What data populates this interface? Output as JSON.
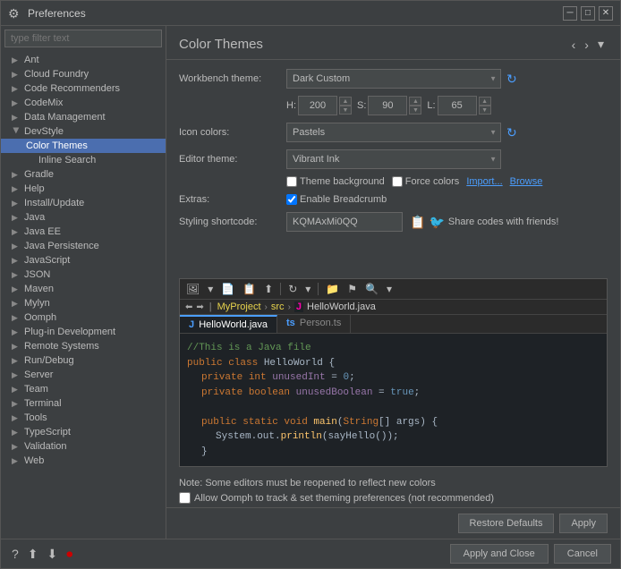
{
  "window": {
    "title": "Preferences",
    "icon": "⚙"
  },
  "filter": {
    "placeholder": "type filter text"
  },
  "sidebar": {
    "items": [
      {
        "id": "ant",
        "label": "Ant",
        "level": "root",
        "expanded": false
      },
      {
        "id": "cloud-foundry",
        "label": "Cloud Foundry",
        "level": "root",
        "expanded": false
      },
      {
        "id": "code-recommenders",
        "label": "Code Recommenders",
        "level": "root",
        "expanded": false
      },
      {
        "id": "codemix",
        "label": "CodeMix",
        "level": "root",
        "expanded": false
      },
      {
        "id": "data-management",
        "label": "Data Management",
        "level": "root",
        "expanded": false
      },
      {
        "id": "devstyle",
        "label": "DevStyle",
        "level": "root",
        "expanded": true
      },
      {
        "id": "color-themes",
        "label": "Color Themes",
        "level": "child",
        "selected": true
      },
      {
        "id": "inline-search",
        "label": "Inline Search",
        "level": "grandchild"
      },
      {
        "id": "gradle",
        "label": "Gradle",
        "level": "root",
        "expanded": false
      },
      {
        "id": "help",
        "label": "Help",
        "level": "root",
        "expanded": false
      },
      {
        "id": "install-update",
        "label": "Install/Update",
        "level": "root",
        "expanded": false
      },
      {
        "id": "java",
        "label": "Java",
        "level": "root",
        "expanded": false
      },
      {
        "id": "java-ee",
        "label": "Java EE",
        "level": "root",
        "expanded": false
      },
      {
        "id": "java-persistence",
        "label": "Java Persistence",
        "level": "root",
        "expanded": false
      },
      {
        "id": "javascript",
        "label": "JavaScript",
        "level": "root",
        "expanded": false
      },
      {
        "id": "json",
        "label": "JSON",
        "level": "root",
        "expanded": false
      },
      {
        "id": "maven",
        "label": "Maven",
        "level": "root",
        "expanded": false
      },
      {
        "id": "mylyn",
        "label": "Mylyn",
        "level": "root",
        "expanded": false
      },
      {
        "id": "oomph",
        "label": "Oomph",
        "level": "root",
        "expanded": false
      },
      {
        "id": "plugin-development",
        "label": "Plug-in Development",
        "level": "root",
        "expanded": false
      },
      {
        "id": "remote-systems",
        "label": "Remote Systems",
        "level": "root",
        "expanded": false
      },
      {
        "id": "run-debug",
        "label": "Run/Debug",
        "level": "root",
        "expanded": false
      },
      {
        "id": "server",
        "label": "Server",
        "level": "root",
        "expanded": false
      },
      {
        "id": "team",
        "label": "Team",
        "level": "root",
        "expanded": false
      },
      {
        "id": "terminal",
        "label": "Terminal",
        "level": "root",
        "expanded": false
      },
      {
        "id": "tools",
        "label": "Tools",
        "level": "root",
        "expanded": false
      },
      {
        "id": "typescript",
        "label": "TypeScript",
        "level": "root",
        "expanded": false
      },
      {
        "id": "validation",
        "label": "Validation",
        "level": "root",
        "expanded": false
      },
      {
        "id": "web",
        "label": "Web",
        "level": "root",
        "expanded": false
      }
    ]
  },
  "content": {
    "title": "Color Themes",
    "workbench_label": "Workbench theme:",
    "workbench_value": "Dark Custom",
    "hsl": {
      "h_label": "H:",
      "h_value": "200",
      "s_label": "S:",
      "s_value": "90",
      "l_label": "L:",
      "l_value": "65"
    },
    "icon_colors_label": "Icon colors:",
    "icon_colors_value": "Pastels",
    "editor_theme_label": "Editor theme:",
    "editor_theme_value": "Vibrant Ink",
    "theme_background_label": "Theme background",
    "force_colors_label": "Force colors",
    "import_label": "Import...",
    "browse_label": "Browse",
    "extras_label": "Extras:",
    "enable_breadcrumb_label": "Enable Breadcrumb",
    "styling_label": "Styling shortcode:",
    "shortcode_value": "KQMAxMi0QQ",
    "share_label": "Share codes with friends!",
    "note": "Note: Some editors must be reopened to reflect new colors",
    "oomph_label": "Allow Oomph to track & set theming preferences (not recommended)",
    "restore_defaults": "Restore Defaults",
    "apply": "Apply"
  },
  "preview": {
    "filename": "HelloWorld.java",
    "path_parts": [
      "MyProject",
      "src",
      "J",
      "HelloWorld.java"
    ],
    "tabs": [
      {
        "label": "HelloWorld.java",
        "prefix": "J",
        "active": true
      },
      {
        "label": "Person.ts",
        "prefix": "ts",
        "active": false
      }
    ],
    "code_lines": [
      {
        "type": "comment",
        "text": "//This is a Java file"
      },
      {
        "type": "mixed",
        "parts": [
          {
            "cls": "code-keyword",
            "text": "public class "
          },
          {
            "cls": "code-class",
            "text": "HelloWorld "
          },
          {
            "cls": "code-plain",
            "text": "{"
          }
        ]
      },
      {
        "type": "mixed",
        "indent": 1,
        "parts": [
          {
            "cls": "code-keyword",
            "text": "private "
          },
          {
            "cls": "code-type",
            "text": "int "
          },
          {
            "cls": "code-varname",
            "text": "unusedInt"
          },
          {
            "cls": "code-plain",
            "text": " = "
          },
          {
            "cls": "code-number",
            "text": "0"
          },
          {
            "cls": "code-plain",
            "text": ";"
          }
        ]
      },
      {
        "type": "mixed",
        "indent": 1,
        "parts": [
          {
            "cls": "code-keyword",
            "text": "private "
          },
          {
            "cls": "code-type",
            "text": "boolean "
          },
          {
            "cls": "code-varname",
            "text": "unusedBoolean"
          },
          {
            "cls": "code-plain",
            "text": " = "
          },
          {
            "cls": "code-bool",
            "text": "true"
          },
          {
            "cls": "code-plain",
            "text": ";"
          }
        ]
      },
      {
        "type": "empty"
      },
      {
        "type": "mixed",
        "indent": 1,
        "parts": [
          {
            "cls": "code-keyword",
            "text": "public static void "
          },
          {
            "cls": "code-method",
            "text": "main"
          },
          {
            "cls": "code-plain",
            "text": "("
          },
          {
            "cls": "code-type",
            "text": "String"
          },
          {
            "cls": "code-plain",
            "text": "[] args) {"
          }
        ]
      },
      {
        "type": "mixed",
        "indent": 2,
        "parts": [
          {
            "cls": "code-plain",
            "text": "System.out."
          },
          {
            "cls": "code-method",
            "text": "println"
          },
          {
            "cls": "code-plain",
            "text": "(sayHello());"
          }
        ]
      },
      {
        "type": "plain",
        "indent": 1,
        "text": "}"
      }
    ]
  },
  "footer": {
    "apply_close": "Apply and Close",
    "cancel": "Cancel",
    "icons": [
      "help-icon",
      "import-icon",
      "export-icon",
      "record-icon"
    ]
  }
}
